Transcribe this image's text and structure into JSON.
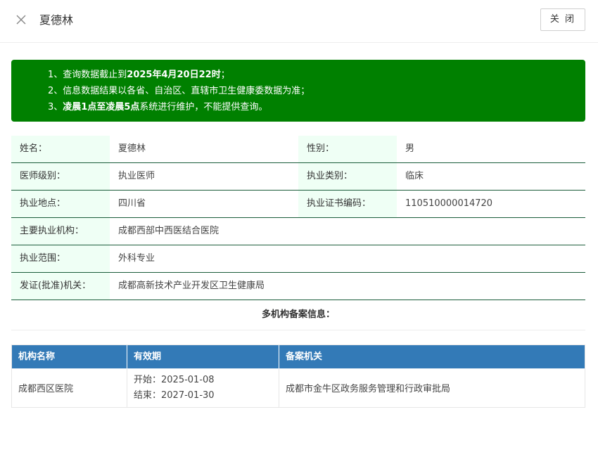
{
  "header": {
    "title": "夏德林",
    "close_label": "关 闭"
  },
  "notice": {
    "line1_prefix": "1、查询数据截止到",
    "line1_bold": "2025年4月20日22时",
    "line1_suffix": "；",
    "line2": "2、信息数据结果以各省、自治区、直辖市卫生健康委数据为准；",
    "line3_prefix": "3、",
    "line3_bold": "凌晨1点至凌晨5点",
    "line3_suffix": "系统进行维护，不能提供查询。",
    "bg_color": "#008000"
  },
  "info": {
    "name_label": "姓名：",
    "name_value": "夏德林",
    "gender_label": "性别：",
    "gender_value": "男",
    "level_label": "医师级别：",
    "level_value": "执业医师",
    "category_label": "执业类别：",
    "category_value": "临床",
    "location_label": "执业地点：",
    "location_value": "四川省",
    "cert_label": "执业证书编码：",
    "cert_value": "110510000014720",
    "org_label": "主要执业机构：",
    "org_value": "成都西部中西医结合医院",
    "scope_label": "执业范围：",
    "scope_value": "外科专业",
    "issuer_label": "发证(批准)机关：",
    "issuer_value": "成都高新技术产业开发区卫生健康局"
  },
  "multi": {
    "title": "多机构备案信息：",
    "columns": [
      "机构名称",
      "有效期",
      "备案机关"
    ],
    "rows": [
      {
        "org": "成都西区医院",
        "start": "开始：2025-01-08",
        "end": "结束：2027-01-30",
        "authority": "成都市金牛区政务服务管理和行政审批局"
      }
    ],
    "header_color": "#337ab7"
  }
}
